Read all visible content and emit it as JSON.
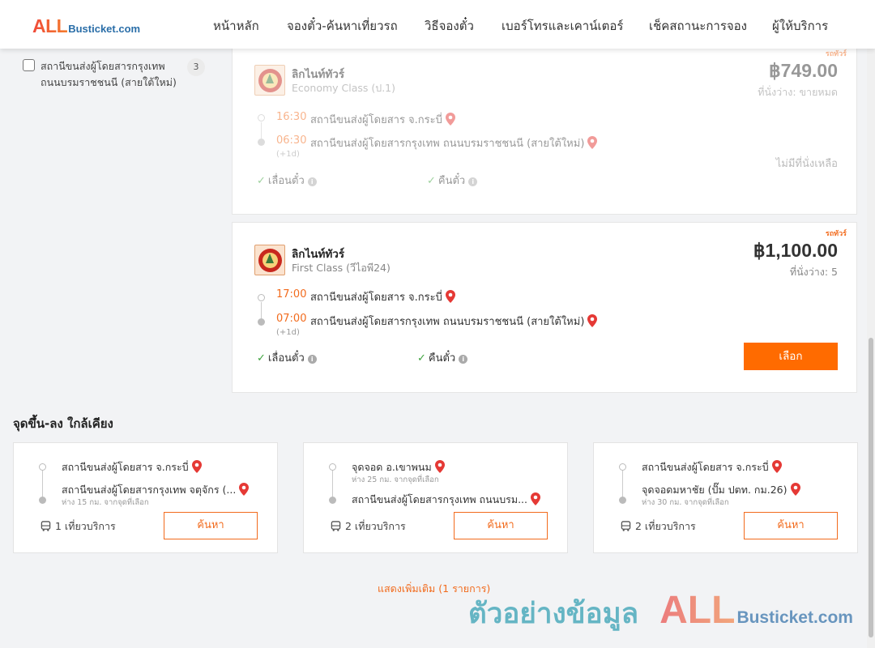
{
  "header": {
    "logo_all": "ALL",
    "logo_rest": "Busticket.com",
    "nav": [
      "หน้าหลัก",
      "จองตั๋ว-ค้นหาเที่ยวรถ",
      "วิธีจองตั๋ว",
      "เบอร์โทรและเคาน์เตอร์",
      "เช็คสถานะการจอง",
      "ผู้ให้บริการ"
    ]
  },
  "filter": {
    "label": "สถานีขนส่งผู้โดยสารกรุงเทพ ถนนบรมราชชนนี (สายใต้ใหม่)",
    "count": "3"
  },
  "trips": [
    {
      "ribbon": "รถทัวร์",
      "operator": "ลิกไนท์ทัวร์",
      "class": "Economy Class (ป.1)",
      "price": "฿749.00",
      "seats": "ที่นั่งว่าง: ขายหมด",
      "depart_time": "16:30",
      "depart_station": "สถานีขนส่งผู้โดยสาร จ.กระบี่",
      "arrive_time": "06:30",
      "arrive_station": "สถานีขนส่งผู้โดยสารกรุงเทพ ถนนบรมราชชนนี (สายใต้ใหม่)",
      "next_day": "(+1d)",
      "feature1": "เลื่อนตั๋ว",
      "feature2": "คืนตั๋ว",
      "status": "ไม่มีที่นั่งเหลือ"
    },
    {
      "ribbon": "รถทัวร์",
      "operator": "ลิกไนท์ทัวร์",
      "class": "First Class (วีไอพี24)",
      "price": "฿1,100.00",
      "seats": "ที่นั่งว่าง: 5",
      "depart_time": "17:00",
      "depart_station": "สถานีขนส่งผู้โดยสาร จ.กระบี่",
      "arrive_time": "07:00",
      "arrive_station": "สถานีขนส่งผู้โดยสารกรุงเทพ ถนนบรมราชชนนี (สายใต้ใหม่)",
      "next_day": "(+1d)",
      "feature1": "เลื่อนตั๋ว",
      "feature2": "คืนตั๋ว",
      "button": "เลือก"
    }
  ],
  "nearby": {
    "title": "จุดขึ้น-ลง ใกล้เคียง",
    "cards": [
      {
        "from": "สถานีขนส่งผู้โดยสาร จ.กระบี่",
        "from_dist": "",
        "to": "สถานีขนส่งผู้โดยสารกรุงเทพ จตุจักร (...",
        "to_dist": "ห่าง 15 กม. จากจุดที่เลือก",
        "trips": "1 เที่ยวบริการ",
        "button": "ค้นหา"
      },
      {
        "from": "จุดจอด อ.เขาพนม",
        "from_dist": "ห่าง 25 กม. จากจุดที่เลือก",
        "to": "สถานีขนส่งผู้โดยสารกรุงเทพ ถนนบรม...",
        "to_dist": "",
        "trips": "2 เที่ยวบริการ",
        "button": "ค้นหา"
      },
      {
        "from": "สถานีขนส่งผู้โดยสาร จ.กระบี่",
        "from_dist": "",
        "to": "จุดจอดมหาชัย (ปั๊ม ปตท. กม.26)",
        "to_dist": "ห่าง 30 กม. จากจุดที่เลือก",
        "trips": "2 เที่ยวบริการ",
        "button": "ค้นหา"
      }
    ]
  },
  "show_more": "แสดงเพิ่มเติม (1 รายการ)",
  "watermark": {
    "text": "ตัวอย่างข้อมูล",
    "all": "ALL",
    "rest": "Busticket.com"
  },
  "colors": {
    "accent": "#ff6b00",
    "pin": "#e53935",
    "check": "#3ea33e"
  },
  "icons": [
    "map-pin-icon",
    "check-icon",
    "info-icon",
    "bus-icon",
    "operator-logo"
  ]
}
